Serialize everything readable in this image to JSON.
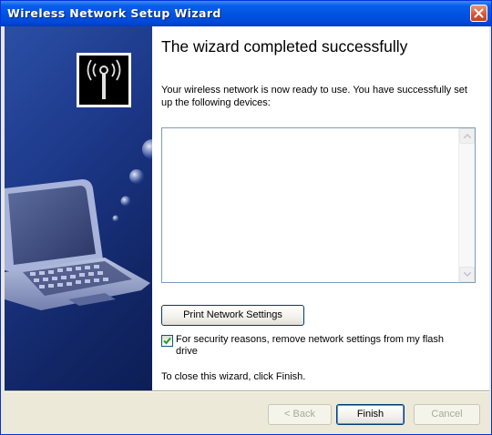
{
  "window": {
    "title": "Wireless Network Setup Wizard"
  },
  "page": {
    "heading": "The wizard completed successfully",
    "intro": "Your wireless network is now ready to use. You have successfully set up the following devices:",
    "devices": [],
    "print_button": "Print Network Settings",
    "checkbox": {
      "checked": true,
      "label": "For security reasons, remove network settings from my flash drive"
    },
    "closing_text": "To close this wizard, click Finish."
  },
  "buttons": {
    "back": "< Back",
    "finish": "Finish",
    "cancel": "Cancel"
  },
  "icons": {
    "close": "close-icon",
    "wireless": "wireless-antenna-icon",
    "laptop": "laptop-illustration",
    "checkmark": "checkmark-icon"
  }
}
